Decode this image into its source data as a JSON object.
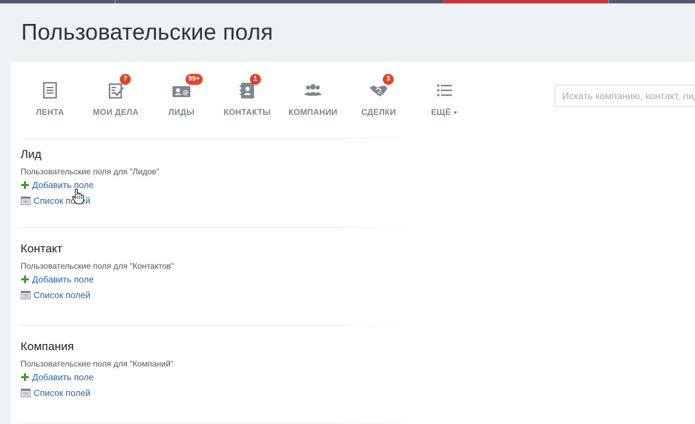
{
  "colors": {
    "topbar": "#535c69",
    "topbar_accent": "#c8373a",
    "badge": "#e34327",
    "link": "#2067b0",
    "plus_icon": "#3e9b2d",
    "nav_icon": "#80868e"
  },
  "page": {
    "title": "Пользовательские поля"
  },
  "nav": {
    "items": [
      {
        "label": "ЛЕНТА",
        "icon": "feed-icon",
        "badge": ""
      },
      {
        "label": "МОИ ДЕЛА",
        "icon": "tasks-icon",
        "badge": "7"
      },
      {
        "label": "ЛИДЫ",
        "icon": "leads-icon",
        "badge": "99+"
      },
      {
        "label": "КОНТАКТЫ",
        "icon": "contacts-icon",
        "badge": "1"
      },
      {
        "label": "КОМПАНИИ",
        "icon": "companies-icon",
        "badge": ""
      },
      {
        "label": "СДЕЛКИ",
        "icon": "deals-icon",
        "badge": "3"
      },
      {
        "label": "ЕЩЁ",
        "icon": "more-icon",
        "badge": ""
      }
    ]
  },
  "search": {
    "placeholder": "Искать компанию, контакт, лид"
  },
  "sections": [
    {
      "title": "Лид",
      "description": "Пользовательские поля для \"Лидов\"",
      "add_label": "Добавить поле",
      "list_label": "Список полей"
    },
    {
      "title": "Контакт",
      "description": "Пользовательские поля для \"Контактов\"",
      "add_label": "Добавить поле",
      "list_label": "Список полей"
    },
    {
      "title": "Компания",
      "description": "Пользовательские поля для \"Компаний\"",
      "add_label": "Добавить поле",
      "list_label": "Список полей"
    }
  ]
}
